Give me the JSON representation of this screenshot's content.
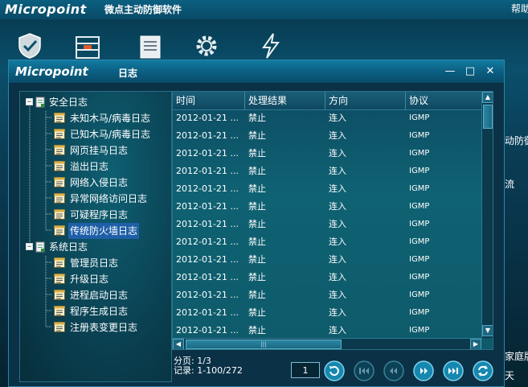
{
  "app": {
    "logo": "Micropoint",
    "title": "微点主动防御软件",
    "help_label": "帮助",
    "side_text_1": "动防御",
    "side_text_2": "流",
    "side_text_3": "家庭版",
    "side_text_4": "天",
    "toolbar_icons": [
      "shield-check-icon",
      "firewall-icon",
      "log-notepad-icon",
      "gear-icon",
      "lightning-icon"
    ]
  },
  "dialog": {
    "logo": "Micropoint",
    "title": "日志",
    "buttons": {
      "minimize": "—",
      "maximize": "□",
      "close": "✕"
    }
  },
  "tree": {
    "groups": [
      {
        "label": "安全日志",
        "expander": "−",
        "items": [
          {
            "label": "未知木马/病毒日志"
          },
          {
            "label": "已知木马/病毒日志"
          },
          {
            "label": "网页挂马日志"
          },
          {
            "label": "溢出日志"
          },
          {
            "label": "网络入侵日志"
          },
          {
            "label": "异常网络访问日志"
          },
          {
            "label": "可疑程序日志"
          },
          {
            "label": "传统防火墙日志",
            "selected": true
          }
        ]
      },
      {
        "label": "系统日志",
        "expander": "−",
        "items": [
          {
            "label": "管理员日志"
          },
          {
            "label": "升级日志"
          },
          {
            "label": "进程启动日志"
          },
          {
            "label": "程序生成日志"
          },
          {
            "label": "注册表变更日志"
          }
        ]
      }
    ]
  },
  "grid": {
    "columns": [
      "时间",
      "处理结果",
      "方向",
      "协议"
    ],
    "rows": [
      [
        "2012-01-21 ...",
        "禁止",
        "连入",
        "IGMP"
      ],
      [
        "2012-01-21 ...",
        "禁止",
        "连入",
        "IGMP"
      ],
      [
        "2012-01-21 ...",
        "禁止",
        "连入",
        "IGMP"
      ],
      [
        "2012-01-21 ...",
        "禁止",
        "连入",
        "IGMP"
      ],
      [
        "2012-01-21 ...",
        "禁止",
        "连入",
        "IGMP"
      ],
      [
        "2012-01-21 ...",
        "禁止",
        "连入",
        "IGMP"
      ],
      [
        "2012-01-21 ...",
        "禁止",
        "连入",
        "IGMP"
      ],
      [
        "2012-01-21 ...",
        "禁止",
        "连入",
        "IGMP"
      ],
      [
        "2012-01-21 ...",
        "禁止",
        "连入",
        "IGMP"
      ],
      [
        "2012-01-21 ...",
        "禁止",
        "连入",
        "IGMP"
      ],
      [
        "2012-01-21 ...",
        "禁止",
        "连入",
        "IGMP"
      ],
      [
        "2012-01-21 ...",
        "禁止",
        "连入",
        "IGMP"
      ],
      [
        "2012-01-21 ...",
        "禁止",
        "连入",
        "IGMP"
      ]
    ],
    "scroll_up": "▲",
    "scroll_down": "▼",
    "scroll_left": "◀",
    "scroll_right": "▶",
    "thumb_grip": "|||"
  },
  "pager": {
    "page_label": "分页: 1/3",
    "records_label": "记录: 1-100/272",
    "page_input_value": "1",
    "nav_icons": [
      "refresh-go-icon",
      "first-page-icon",
      "prev-page-icon",
      "next-page-icon",
      "last-page-icon",
      "refresh-icon"
    ]
  },
  "colors": {
    "accent": "#117aa0",
    "selection": "#1f5fa8",
    "panel": "#0d5a6a"
  }
}
